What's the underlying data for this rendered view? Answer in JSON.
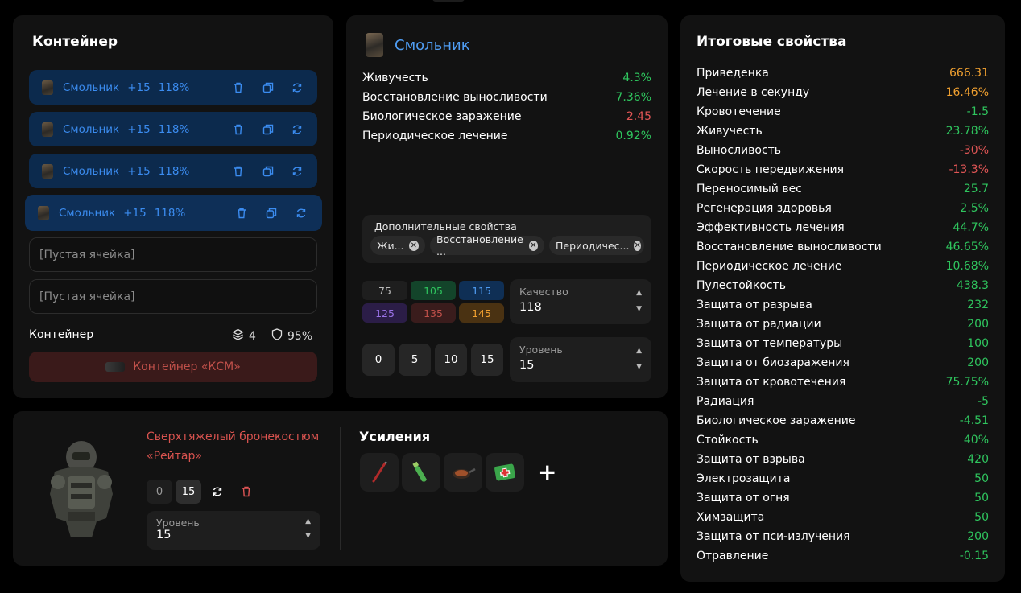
{
  "container": {
    "title": "Контейнер",
    "slots": [
      {
        "name": "Смольник",
        "level": "+15",
        "percent": "118%"
      },
      {
        "name": "Смольник",
        "level": "+15",
        "percent": "118%"
      },
      {
        "name": "Смольник",
        "level": "+15",
        "percent": "118%"
      },
      {
        "name": "Смольник",
        "level": "+15",
        "percent": "118%"
      }
    ],
    "empty_slots": [
      "[Пустая ячейка]",
      "[Пустая ячейка]"
    ],
    "footer_label": "Контейнер",
    "capacity": "4",
    "protection": "95%",
    "container_item": "Контейнер «КСМ»"
  },
  "item": {
    "name": "Смольник",
    "stats": [
      {
        "label": "Живучесть",
        "value": "4.3%",
        "color": "#2fc55e"
      },
      {
        "label": "Восстановление выносливости",
        "value": "7.36%",
        "color": "#2fc55e"
      },
      {
        "label": "Биологическое заражение",
        "value": "2.45",
        "color": "#e05555"
      },
      {
        "label": "Периодическое лечение",
        "value": "0.92%",
        "color": "#2fc55e"
      }
    ],
    "extras_label": "Дополнительные свойства",
    "extras_chips": [
      "Жи...",
      "Восстановление ...",
      "Периодичес..."
    ],
    "quality_buttons": [
      "75",
      "105",
      "115",
      "125",
      "135",
      "145"
    ],
    "quality_label": "Качество",
    "quality_value": "118",
    "level_buttons": [
      "0",
      "5",
      "10",
      "15"
    ],
    "level_label": "Уровень",
    "level_value": "15"
  },
  "final": {
    "title": "Итоговые свойства",
    "rows": [
      {
        "label": "Приведенка",
        "value": "666.31",
        "tone": "o"
      },
      {
        "label": "Лечение в секунду",
        "value": "16.46%",
        "tone": "o"
      },
      {
        "label": "Кровотечение",
        "value": "-1.5",
        "tone": "g"
      },
      {
        "label": "Живучесть",
        "value": "23.78%",
        "tone": "g"
      },
      {
        "label": "Выносливость",
        "value": "-30%",
        "tone": "r"
      },
      {
        "label": "Скорость передвижения",
        "value": "-13.3%",
        "tone": "r"
      },
      {
        "label": "Переносимый вес",
        "value": "25.7",
        "tone": "g"
      },
      {
        "label": "Регенерация здоровья",
        "value": "2.5%",
        "tone": "g"
      },
      {
        "label": "Эффективность лечения",
        "value": "44.7%",
        "tone": "g"
      },
      {
        "label": "Восстановление выносливости",
        "value": "46.65%",
        "tone": "g"
      },
      {
        "label": "Периодическое лечение",
        "value": "10.68%",
        "tone": "g"
      },
      {
        "label": "Пулестойкость",
        "value": "438.3",
        "tone": "g"
      },
      {
        "label": "Защита от разрыва",
        "value": "232",
        "tone": "g"
      },
      {
        "label": "Защита от радиации",
        "value": "200",
        "tone": "g"
      },
      {
        "label": "Защита от температуры",
        "value": "100",
        "tone": "g"
      },
      {
        "label": "Защита от биозаражения",
        "value": "200",
        "tone": "g"
      },
      {
        "label": "Защита от кровотечения",
        "value": "75.75%",
        "tone": "g"
      },
      {
        "label": "Радиация",
        "value": "-5",
        "tone": "g"
      },
      {
        "label": "Биологическое заражение",
        "value": "-4.51",
        "tone": "g"
      },
      {
        "label": "Стойкость",
        "value": "40%",
        "tone": "g"
      },
      {
        "label": "Защита от взрыва",
        "value": "420",
        "tone": "g"
      },
      {
        "label": "Электрозащита",
        "value": "50",
        "tone": "g"
      },
      {
        "label": "Защита от огня",
        "value": "50",
        "tone": "g"
      },
      {
        "label": "Химзащита",
        "value": "50",
        "tone": "g"
      },
      {
        "label": "Защита от пси-излучения",
        "value": "200",
        "tone": "g"
      },
      {
        "label": "Отравление",
        "value": "-0.15",
        "tone": "g"
      }
    ]
  },
  "armor": {
    "name": "Сверхтяжелый бронекостюм «Рейтар»",
    "btn_zero": "0",
    "btn_fifteen": "15",
    "level_label": "Уровень",
    "level_value": "15",
    "boosts_title": "Усиления",
    "boost_icons": [
      "syringe-icon",
      "bottle-icon",
      "food-pan-icon",
      "medkit-icon"
    ],
    "add_label": "+"
  },
  "colors": {
    "accent_blue": "#3b8cf0",
    "positive": "#2fc55e",
    "negative": "#e05555",
    "highlight": "#f0a030"
  }
}
